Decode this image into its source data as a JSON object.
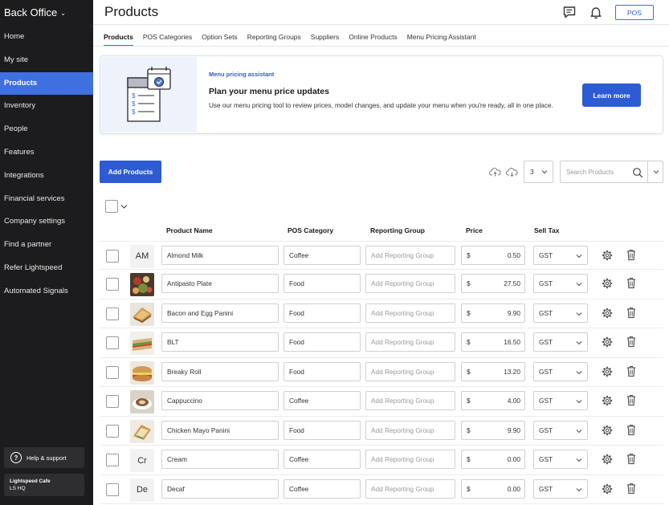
{
  "app": {
    "brand": "Back Office"
  },
  "sidebar": {
    "items": [
      {
        "label": "Home",
        "active": false
      },
      {
        "label": "My site",
        "active": false
      },
      {
        "label": "Products",
        "active": true
      },
      {
        "label": "Inventory",
        "active": false
      },
      {
        "label": "People",
        "active": false
      },
      {
        "label": "Features",
        "active": false
      },
      {
        "label": "Integrations",
        "active": false
      },
      {
        "label": "Financial services",
        "active": false
      },
      {
        "label": "Company settings",
        "active": false
      },
      {
        "label": "Find a partner",
        "active": false
      },
      {
        "label": "Refer Lightspeed",
        "active": false
      },
      {
        "label": "Automated Signals",
        "active": false
      }
    ],
    "help_label": "Help & support",
    "account": {
      "name": "Lightspeed Cafe",
      "location": "LS HQ"
    }
  },
  "header": {
    "title": "Products",
    "pos_label": "POS",
    "icons": [
      "chat-icon",
      "bell-icon"
    ]
  },
  "tabs": [
    {
      "label": "Products",
      "active": true
    },
    {
      "label": "POS Categories",
      "active": false
    },
    {
      "label": "Option Sets",
      "active": false
    },
    {
      "label": "Reporting Groups",
      "active": false
    },
    {
      "label": "Suppliers",
      "active": false
    },
    {
      "label": "Online Products",
      "active": false
    },
    {
      "label": "Menu Pricing Assistant",
      "active": false
    }
  ],
  "banner": {
    "kicker": "Menu pricing assistant",
    "title": "Plan your menu price updates",
    "body": "Use our menu pricing tool to review prices, model changes, and update your menu when you're ready, all in one place.",
    "button": "Learn more"
  },
  "toolbar": {
    "add_label": "Add Products",
    "count_value": "3",
    "search_placeholder": "Search Products"
  },
  "table": {
    "columns": [
      "Product Name",
      "POS Category",
      "Reporting Group",
      "Price",
      "Sell Tax"
    ],
    "reporting_placeholder": "Add Reporting Group",
    "currency": "$",
    "rows": [
      {
        "initials": "AM",
        "image": "",
        "name": "Almond Milk",
        "category": "Coffee",
        "price": "0.50",
        "tax": "GST"
      },
      {
        "initials": "",
        "image": "antipasto-photo",
        "name": "Antipasto Plate",
        "category": "Food",
        "price": "27.50",
        "tax": "GST"
      },
      {
        "initials": "",
        "image": "panini-photo",
        "name": "Bacon and Egg Panini",
        "category": "Food",
        "price": "9.90",
        "tax": "GST"
      },
      {
        "initials": "",
        "image": "blt-photo",
        "name": "BLT",
        "category": "Food",
        "price": "16.50",
        "tax": "GST"
      },
      {
        "initials": "",
        "image": "roll-photo",
        "name": "Breaky Roll",
        "category": "Food",
        "price": "13.20",
        "tax": "GST"
      },
      {
        "initials": "",
        "image": "cappuccino-photo",
        "name": "Cappuccino",
        "category": "Coffee",
        "price": "4.00",
        "tax": "GST"
      },
      {
        "initials": "",
        "image": "chicken-panini-photo",
        "name": "Chicken Mayo Panini",
        "category": "Food",
        "price": "9.90",
        "tax": "GST"
      },
      {
        "initials": "Cr",
        "image": "",
        "name": "Cream",
        "category": "Coffee",
        "price": "0.00",
        "tax": "GST"
      },
      {
        "initials": "De",
        "image": "",
        "name": "Decaf",
        "category": "Coffee",
        "price": "0.00",
        "tax": "GST"
      }
    ]
  },
  "colors": {
    "accent": "#2d5bd4",
    "sidebar": "#1c1c1e",
    "nav_active": "#3f70e0"
  }
}
